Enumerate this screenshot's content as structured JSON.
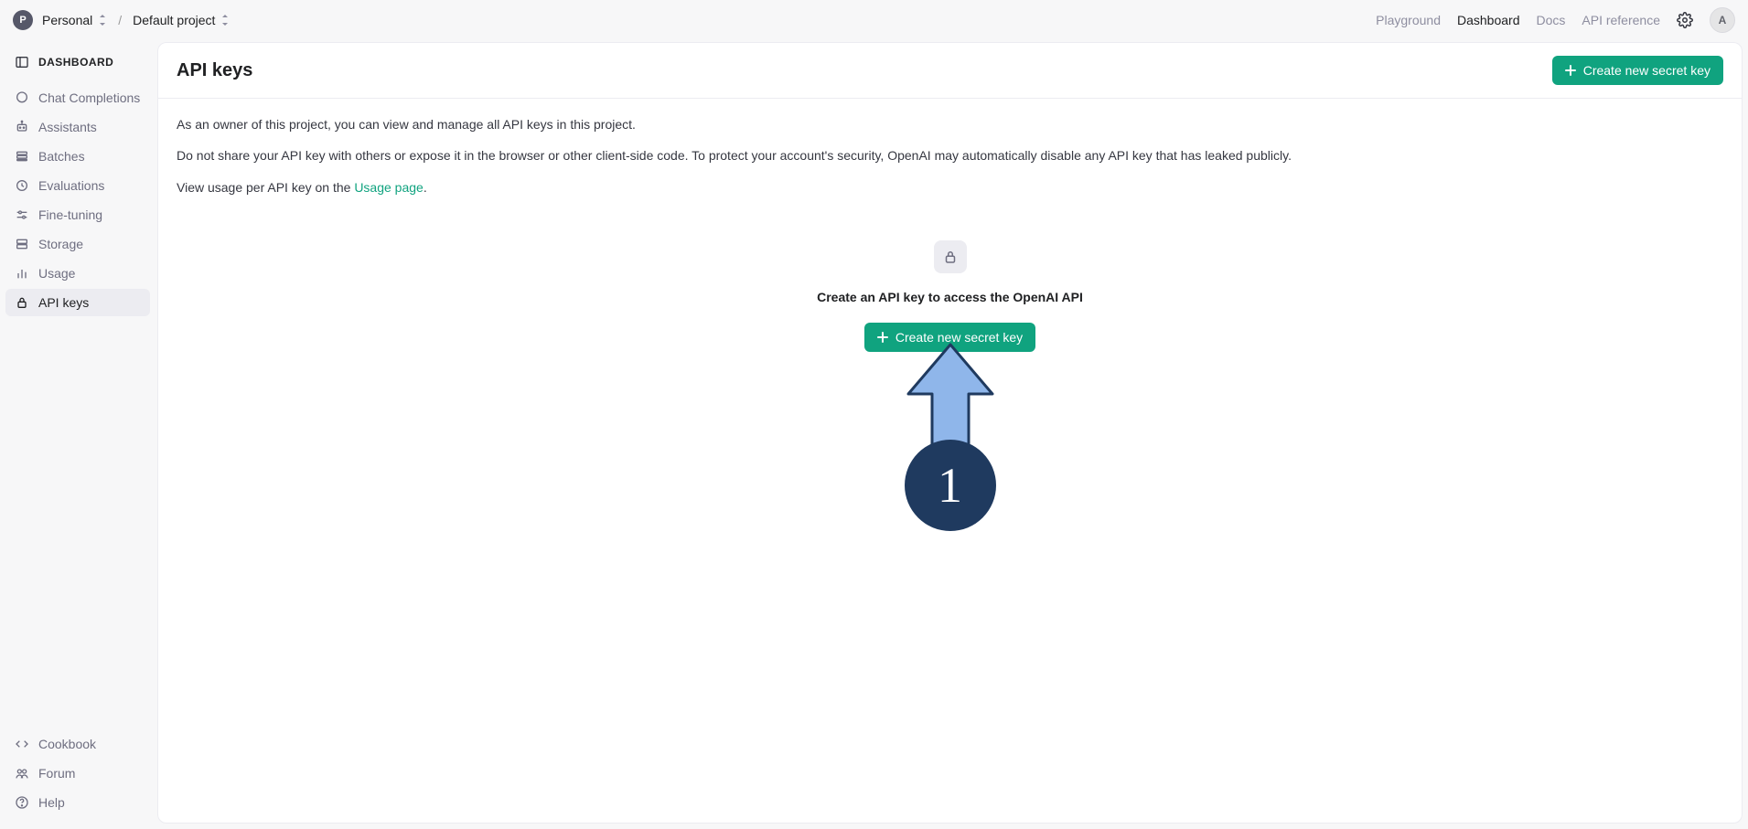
{
  "topbar": {
    "org_initial": "P",
    "org_name": "Personal",
    "project_name": "Default project",
    "nav": {
      "playground": "Playground",
      "dashboard": "Dashboard",
      "docs": "Docs",
      "api_reference": "API reference"
    },
    "user_initial": "A"
  },
  "sidebar": {
    "header": "DASHBOARD",
    "items": [
      {
        "label": "Chat Completions"
      },
      {
        "label": "Assistants"
      },
      {
        "label": "Batches"
      },
      {
        "label": "Evaluations"
      },
      {
        "label": "Fine-tuning"
      },
      {
        "label": "Storage"
      },
      {
        "label": "Usage"
      },
      {
        "label": "API keys"
      }
    ],
    "footer": [
      {
        "label": "Cookbook"
      },
      {
        "label": "Forum"
      },
      {
        "label": "Help"
      }
    ]
  },
  "main": {
    "title": "API keys",
    "create_button": "Create new secret key",
    "intro_p1": "As an owner of this project, you can view and manage all API keys in this project.",
    "intro_p2": "Do not share your API key with others or expose it in the browser or other client-side code. To protect your account's security, OpenAI may automatically disable any API key that has leaked publicly.",
    "intro_p3_prefix": "View usage per API key on the ",
    "intro_p3_link": "Usage page",
    "intro_p3_suffix": ".",
    "empty_headline": "Create an API key to access the OpenAI API"
  },
  "annotation": {
    "step_number": "1"
  }
}
